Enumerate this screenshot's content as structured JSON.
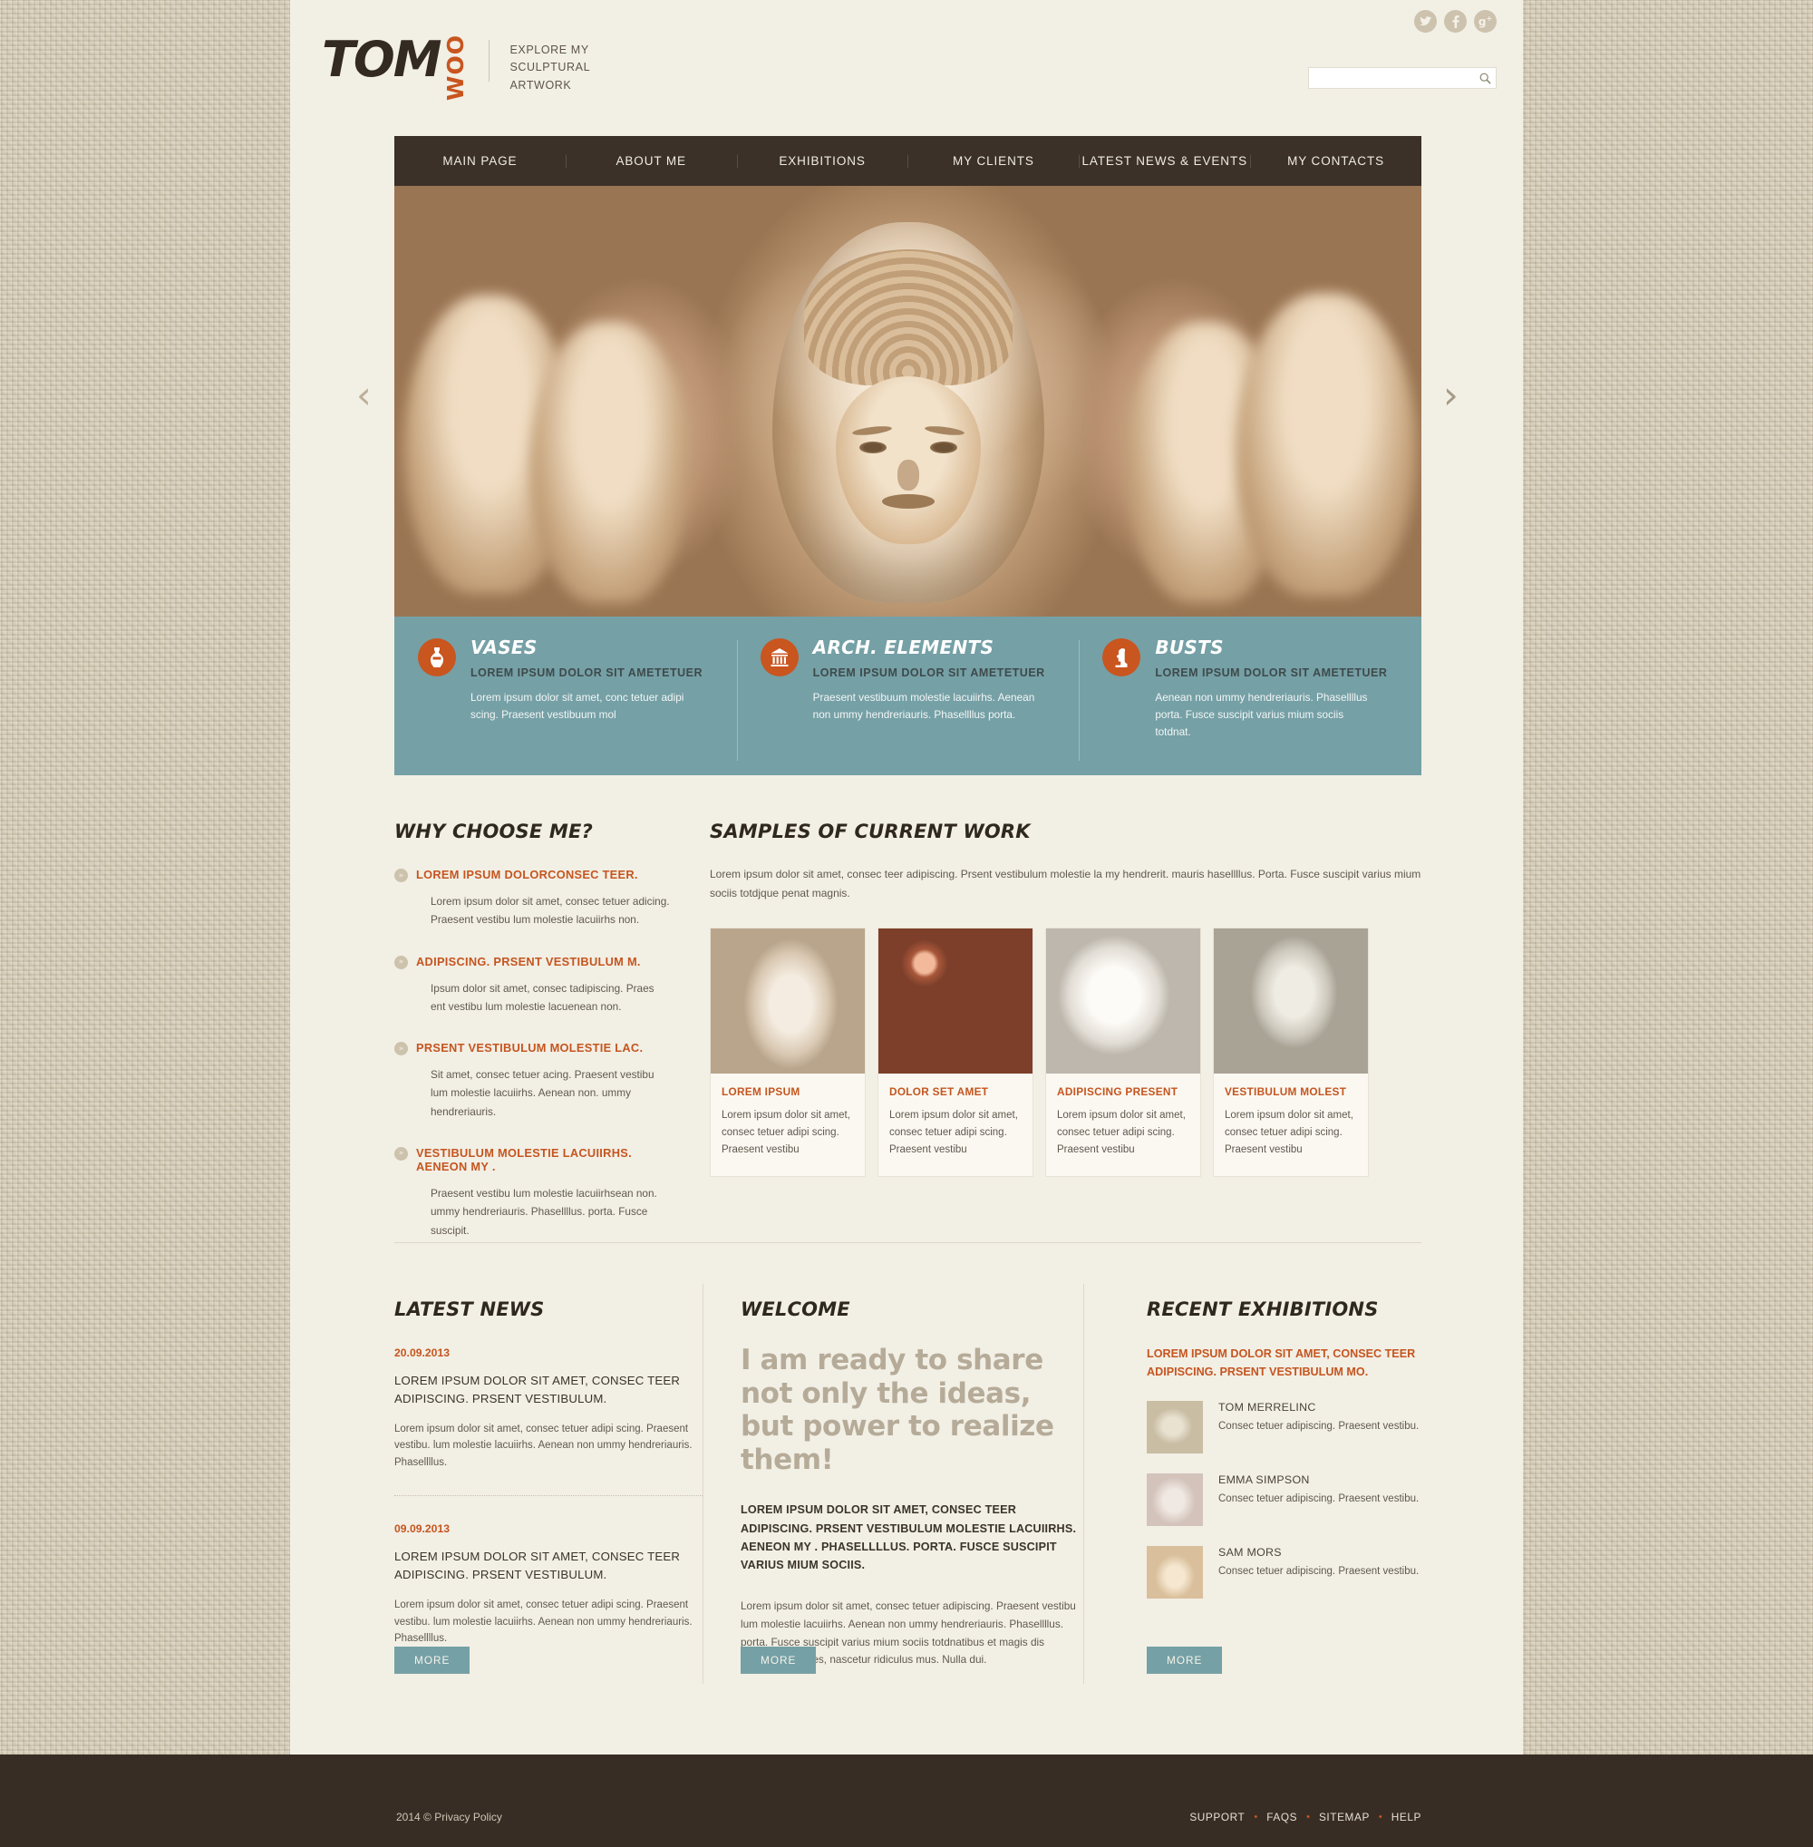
{
  "header": {
    "logo_main": "TOM",
    "logo_accent": "WOO",
    "tagline": "Explore my sculptural artwork",
    "social": [
      {
        "name": "twitter-icon",
        "glyph": "ᵗ"
      },
      {
        "name": "facebook-icon",
        "glyph": "f"
      },
      {
        "name": "google-plus-icon",
        "glyph": "g+"
      }
    ],
    "search": {
      "value": "",
      "placeholder": "",
      "icon": "search-icon",
      "glyph": "⌕"
    }
  },
  "nav": {
    "items": [
      {
        "label": "MAIN PAGE"
      },
      {
        "label": "ABOUT ME"
      },
      {
        "label": "EXHIBITIONS"
      },
      {
        "label": "MY  CLIENTS"
      },
      {
        "label": "LATEST NEWS & EVENTS"
      },
      {
        "label": "MY CONTACTS"
      }
    ]
  },
  "slider": {
    "prev_glyph": "‹",
    "next_glyph": "›",
    "alt": "Close-up of carved stone statue faces in warm sepia tones"
  },
  "features": [
    {
      "icon": "vase-icon",
      "glyph": "⚱",
      "title": "VASES",
      "subtitle": "LOREM IPSUM DOLOR SIT AMETETUER",
      "text": "Lorem ipsum dolor sit amet, conc tetuer adipi scing. Praesent vestibuum mol"
    },
    {
      "icon": "temple-icon",
      "glyph": "⛪",
      "title": "ARCH. ELEMENTS",
      "subtitle": "LOREM IPSUM DOLOR SIT AMETETUER",
      "text": "Praesent vestibuum molestie lacuiirhs. Aenean non ummy hendreriauris. Phasellllus porta."
    },
    {
      "icon": "bust-icon",
      "glyph": "♟",
      "title": "BUSTS",
      "subtitle": "LOREM IPSUM DOLOR SIT AMETETUER",
      "text": "Aenean non ummy hendreriauris. Phasellllus porta. Fusce suscipit varius mium sociis totdnat."
    }
  ],
  "why_choose": {
    "title": "WHY CHOOSE ME?",
    "bullet_glyph": "»",
    "items": [
      {
        "head": "LOREM IPSUM DOLORCONSEC TEER.",
        "text": "Lorem ipsum dolor sit amet, consec tetuer adicing. Praesent vestibu lum molestie lacuiirhs non."
      },
      {
        "head": "ADIPISCING. PRSENT VESTIBULUM M.",
        "text": "Ipsum dolor sit amet, consec tadipiscing. Praes ent vestibu lum molestie lacuenean non."
      },
      {
        "head": "PRSENT VESTIBULUM MOLESTIE LAC.",
        "text": "Sit amet, consec tetuer acing. Praesent vestibu lum molestie lacuiirhs.  Aenean non. ummy hendreriauris."
      },
      {
        "head": "VESTIBULUM MOLESTIE LACUIIRHS. AENEON MY .",
        "text": "Praesent vestibu lum molestie lacuiirhsean non. ummy hendreriauris. Phasellllus. porta. Fusce suscipit."
      }
    ]
  },
  "samples": {
    "title": "SAMPLES OF CURRENT WORK",
    "intro": "Lorem ipsum dolor sit amet, consec teer adipiscing. Prsent vestibulum molestie la my hendrerit. mauris hasellllus. Porta. Fusce suscipit varius mium sociis totdjque penat magnis.",
    "cards": [
      {
        "image": "marble-bust-thumbnail",
        "title": "LOREM IPSUM",
        "text": "Lorem ipsum dolor sit amet, consec tetuer adipi scing. Praesent vestibu"
      },
      {
        "image": "terracotta-pots-thumbnail",
        "title": "DOLOR SET AMET",
        "text": "Lorem ipsum dolor sit amet, consec tetuer adipi scing. Praesent vestibu"
      },
      {
        "image": "white-cherub-thumbnail",
        "title": "ADIPISCING PRESENT",
        "text": "Lorem ipsum dolor sit amet, consec tetuer adipi scing. Praesent vestibu"
      },
      {
        "image": "stone-angel-thumbnail",
        "title": "VESTIBULUM MOLEST",
        "text": "Lorem ipsum dolor sit amet, consec tetuer adipi scing. Praesent vestibu"
      }
    ]
  },
  "latest_news": {
    "title": "LATEST NEWS",
    "more_label": "MORE",
    "items": [
      {
        "date": "20.09.2013",
        "head": "LOREM IPSUM DOLOR SIT AMET, CONSEC TEER ADIPISCING. PRSENT VESTIBULUM.",
        "text": "Lorem ipsum dolor sit amet, consec tetuer adipi scing. Praesent vestibu.  lum molestie lacuiirhs. Aenean non ummy hendreriauris. Phasellllus."
      },
      {
        "date": "09.09.2013",
        "head": "LOREM IPSUM DOLOR SIT AMET, CONSEC TEER ADIPISCING. PRSENT VESTIBULUM.",
        "text": "Lorem ipsum dolor sit amet, consec tetuer adipi scing. Praesent vestibu.  lum molestie lacuiirhs. Aenean non ummy hendreriauris. Phasellllus."
      }
    ]
  },
  "welcome": {
    "title": "WELCOME",
    "quote": "I am ready to share not only the ideas, but power to realize them!",
    "bold": "LOREM IPSUM DOLOR SIT AMET, CONSEC TEER ADIPISCING. PRSENT VESTIBULUM MOLESTIE LACUIIRHS. AENEON MY . PHASELLLLUS. PORTA. FUSCE SUSCIPIT VARIUS MIUM SOCIIS.",
    "text": "Lorem ipsum dolor sit amet, consec tetuer adipiscing. Praesent vestibu lum molestie lacuiirhs. Aenean non ummy hendreriauris. Phasellllus. porta. Fusce suscipit varius mium sociis totdnatibus et magis dis parturient montes, nascetur ridiculus mus. Nulla dui.",
    "more_label": "MORE"
  },
  "recent_exhibitions": {
    "title": "RECENT EXHIBITIONS",
    "lead": "LOREM IPSUM DOLOR SIT AMET, CONSEC TEER ADIPISCING. PRSENT VESTIBULUM MO.",
    "more_label": "MORE",
    "items": [
      {
        "image": "laughing-buddha-thumbnail",
        "name": "TOM MERRELINC",
        "text": "Consec tetuer adipiscing. Praesent vestibu."
      },
      {
        "image": "cherub-angel-thumbnail",
        "name": "EMMA SIMPSON",
        "text": "Consec tetuer adipiscing. Praesent vestibu."
      },
      {
        "image": "elephant-figurine-thumbnail",
        "name": "SAM MORS",
        "text": "Consec tetuer adipiscing. Praesent vestibu."
      }
    ]
  },
  "footer": {
    "copyright": "2014 © Privacy Policy",
    "separator": "•",
    "links": [
      {
        "label": "SUPPORT"
      },
      {
        "label": "FAQS"
      },
      {
        "label": "SITEMAP"
      },
      {
        "label": "HELP"
      }
    ]
  },
  "colors": {
    "accent_orange": "#c5551f",
    "teal": "#75a0a6",
    "dark_brown": "#3b3129",
    "page_cream": "#f2efe5",
    "linen_bg": "#cfc3ab"
  }
}
